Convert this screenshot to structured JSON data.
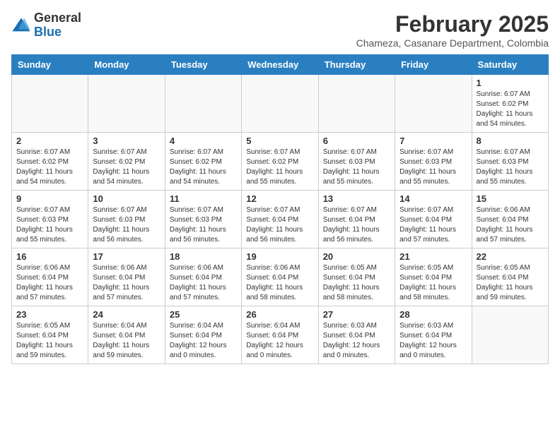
{
  "header": {
    "logo_general": "General",
    "logo_blue": "Blue",
    "month_year": "February 2025",
    "location": "Chameza, Casanare Department, Colombia"
  },
  "weekdays": [
    "Sunday",
    "Monday",
    "Tuesday",
    "Wednesday",
    "Thursday",
    "Friday",
    "Saturday"
  ],
  "weeks": [
    [
      {
        "day": "",
        "info": ""
      },
      {
        "day": "",
        "info": ""
      },
      {
        "day": "",
        "info": ""
      },
      {
        "day": "",
        "info": ""
      },
      {
        "day": "",
        "info": ""
      },
      {
        "day": "",
        "info": ""
      },
      {
        "day": "1",
        "info": "Sunrise: 6:07 AM\nSunset: 6:02 PM\nDaylight: 11 hours\nand 54 minutes."
      }
    ],
    [
      {
        "day": "2",
        "info": "Sunrise: 6:07 AM\nSunset: 6:02 PM\nDaylight: 11 hours\nand 54 minutes."
      },
      {
        "day": "3",
        "info": "Sunrise: 6:07 AM\nSunset: 6:02 PM\nDaylight: 11 hours\nand 54 minutes."
      },
      {
        "day": "4",
        "info": "Sunrise: 6:07 AM\nSunset: 6:02 PM\nDaylight: 11 hours\nand 54 minutes."
      },
      {
        "day": "5",
        "info": "Sunrise: 6:07 AM\nSunset: 6:02 PM\nDaylight: 11 hours\nand 55 minutes."
      },
      {
        "day": "6",
        "info": "Sunrise: 6:07 AM\nSunset: 6:03 PM\nDaylight: 11 hours\nand 55 minutes."
      },
      {
        "day": "7",
        "info": "Sunrise: 6:07 AM\nSunset: 6:03 PM\nDaylight: 11 hours\nand 55 minutes."
      },
      {
        "day": "8",
        "info": "Sunrise: 6:07 AM\nSunset: 6:03 PM\nDaylight: 11 hours\nand 55 minutes."
      }
    ],
    [
      {
        "day": "9",
        "info": "Sunrise: 6:07 AM\nSunset: 6:03 PM\nDaylight: 11 hours\nand 55 minutes."
      },
      {
        "day": "10",
        "info": "Sunrise: 6:07 AM\nSunset: 6:03 PM\nDaylight: 11 hours\nand 56 minutes."
      },
      {
        "day": "11",
        "info": "Sunrise: 6:07 AM\nSunset: 6:03 PM\nDaylight: 11 hours\nand 56 minutes."
      },
      {
        "day": "12",
        "info": "Sunrise: 6:07 AM\nSunset: 6:04 PM\nDaylight: 11 hours\nand 56 minutes."
      },
      {
        "day": "13",
        "info": "Sunrise: 6:07 AM\nSunset: 6:04 PM\nDaylight: 11 hours\nand 56 minutes."
      },
      {
        "day": "14",
        "info": "Sunrise: 6:07 AM\nSunset: 6:04 PM\nDaylight: 11 hours\nand 57 minutes."
      },
      {
        "day": "15",
        "info": "Sunrise: 6:06 AM\nSunset: 6:04 PM\nDaylight: 11 hours\nand 57 minutes."
      }
    ],
    [
      {
        "day": "16",
        "info": "Sunrise: 6:06 AM\nSunset: 6:04 PM\nDaylight: 11 hours\nand 57 minutes."
      },
      {
        "day": "17",
        "info": "Sunrise: 6:06 AM\nSunset: 6:04 PM\nDaylight: 11 hours\nand 57 minutes."
      },
      {
        "day": "18",
        "info": "Sunrise: 6:06 AM\nSunset: 6:04 PM\nDaylight: 11 hours\nand 57 minutes."
      },
      {
        "day": "19",
        "info": "Sunrise: 6:06 AM\nSunset: 6:04 PM\nDaylight: 11 hours\nand 58 minutes."
      },
      {
        "day": "20",
        "info": "Sunrise: 6:05 AM\nSunset: 6:04 PM\nDaylight: 11 hours\nand 58 minutes."
      },
      {
        "day": "21",
        "info": "Sunrise: 6:05 AM\nSunset: 6:04 PM\nDaylight: 11 hours\nand 58 minutes."
      },
      {
        "day": "22",
        "info": "Sunrise: 6:05 AM\nSunset: 6:04 PM\nDaylight: 11 hours\nand 59 minutes."
      }
    ],
    [
      {
        "day": "23",
        "info": "Sunrise: 6:05 AM\nSunset: 6:04 PM\nDaylight: 11 hours\nand 59 minutes."
      },
      {
        "day": "24",
        "info": "Sunrise: 6:04 AM\nSunset: 6:04 PM\nDaylight: 11 hours\nand 59 minutes."
      },
      {
        "day": "25",
        "info": "Sunrise: 6:04 AM\nSunset: 6:04 PM\nDaylight: 12 hours\nand 0 minutes."
      },
      {
        "day": "26",
        "info": "Sunrise: 6:04 AM\nSunset: 6:04 PM\nDaylight: 12 hours\nand 0 minutes."
      },
      {
        "day": "27",
        "info": "Sunrise: 6:03 AM\nSunset: 6:04 PM\nDaylight: 12 hours\nand 0 minutes."
      },
      {
        "day": "28",
        "info": "Sunrise: 6:03 AM\nSunset: 6:04 PM\nDaylight: 12 hours\nand 0 minutes."
      },
      {
        "day": "",
        "info": ""
      }
    ]
  ]
}
